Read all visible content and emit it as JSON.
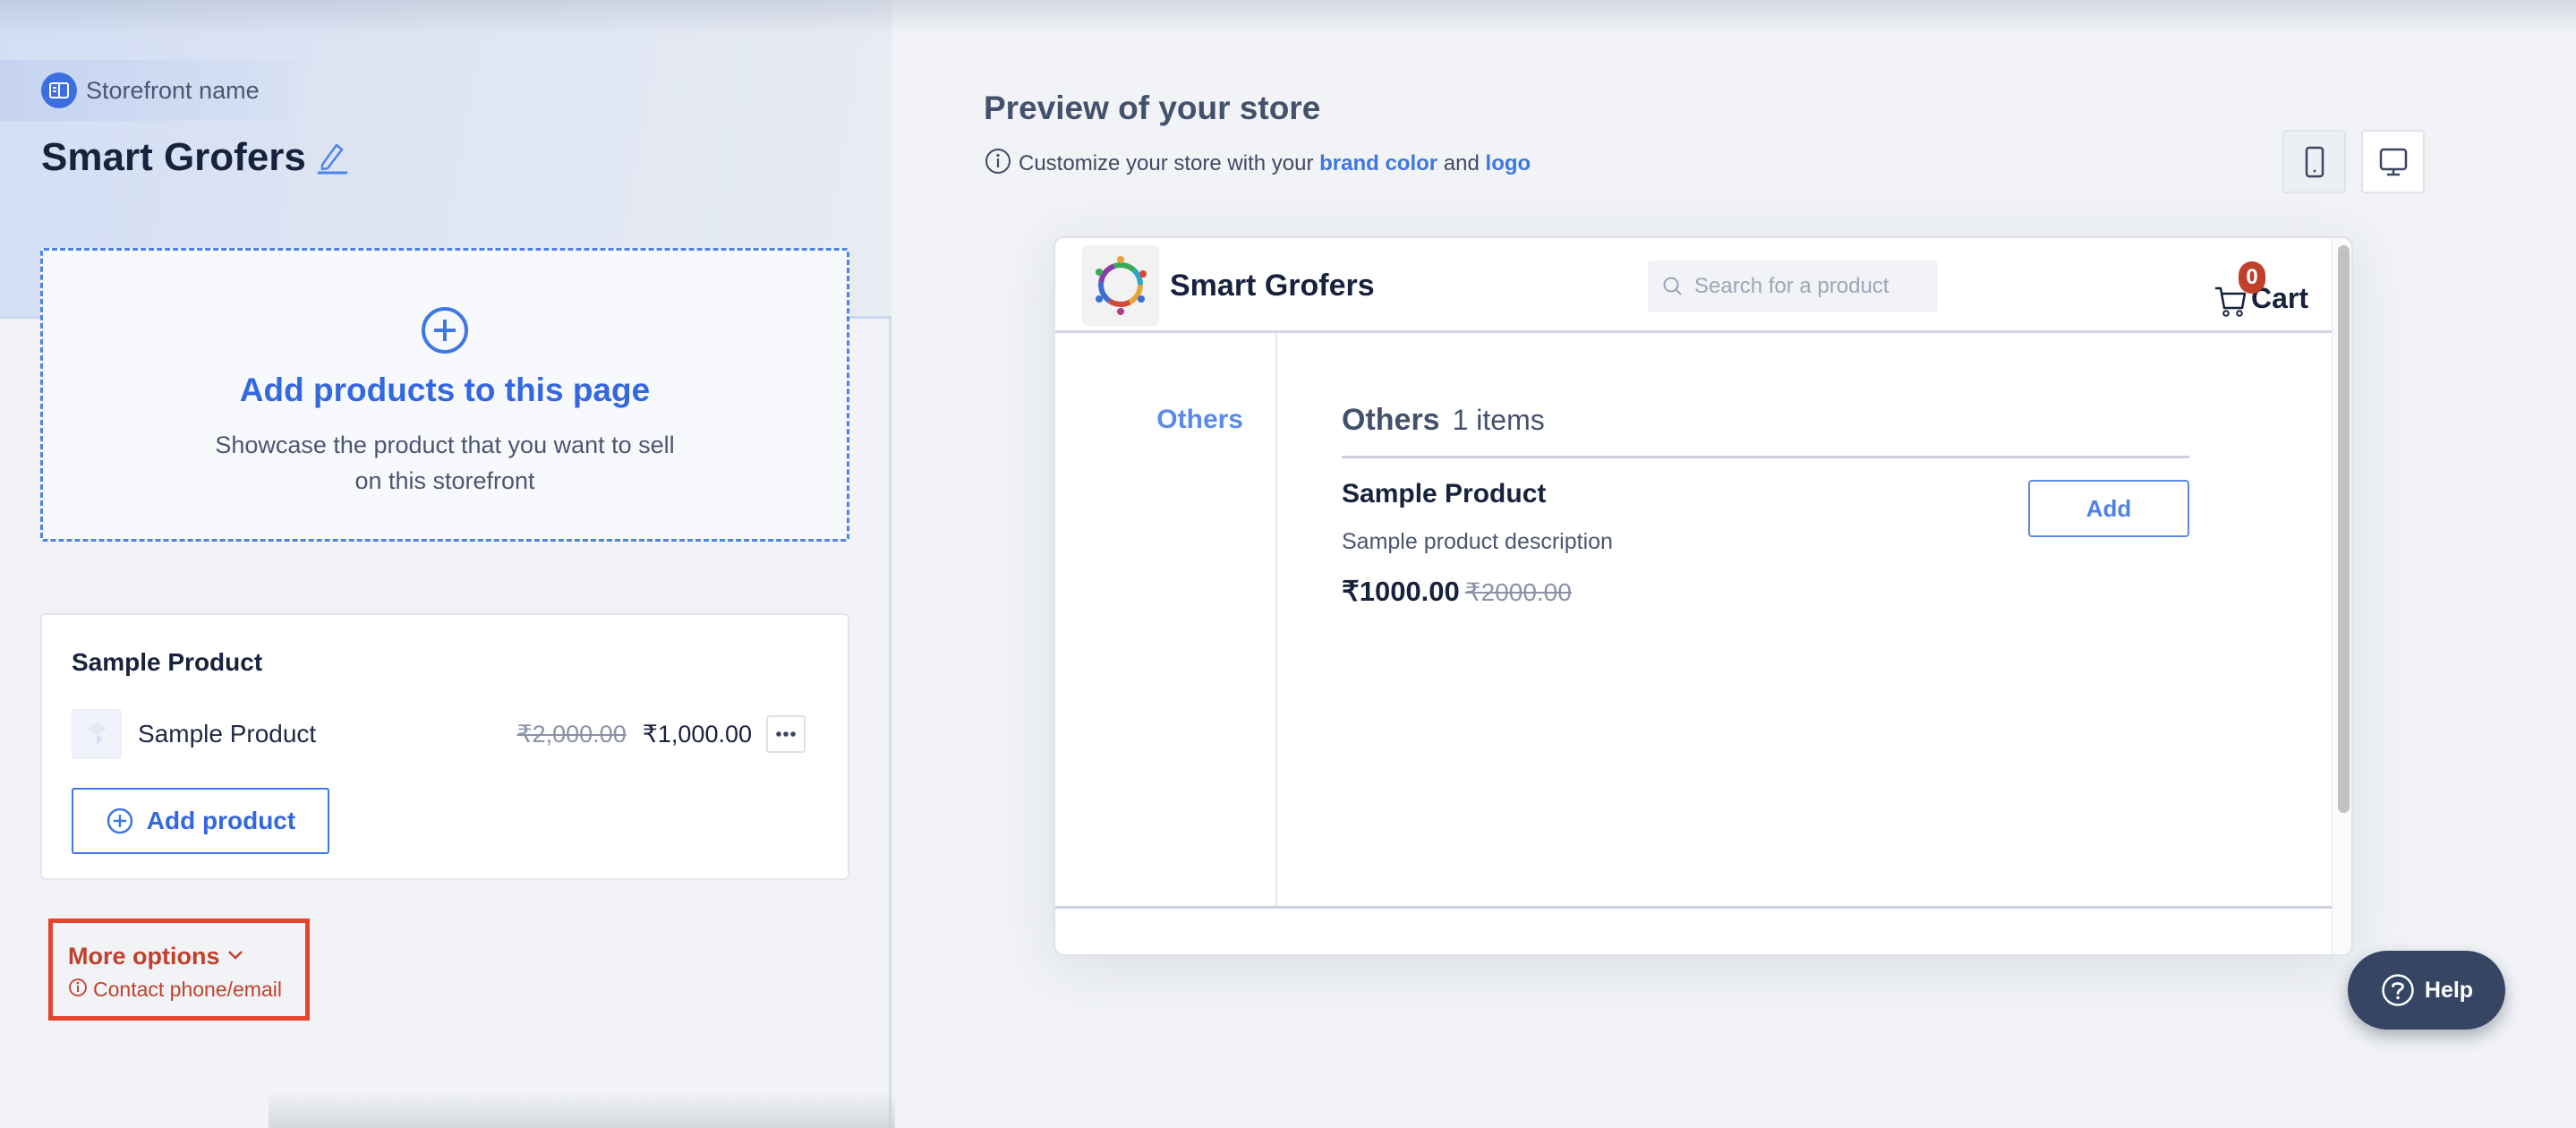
{
  "left_panel": {
    "storefront_label": "Storefront name",
    "store_name": "Smart Grofers",
    "drop_zone": {
      "title": "Add products to this page",
      "subtitle": "Showcase the product that you want to sell on this storefront"
    },
    "product_card": {
      "title": "Sample Product",
      "items": [
        {
          "name": "Sample Product",
          "original_price": "₹2,000.00",
          "price": "₹1,000.00"
        }
      ],
      "add_button_label": "Add product"
    },
    "more_options": {
      "label": "More options",
      "warning": "Contact phone/email"
    }
  },
  "right_panel": {
    "title": "Preview of your store",
    "subtitle_prefix": "Customize your store with your ",
    "subtitle_link1": "brand color",
    "subtitle_mid": " and ",
    "subtitle_link2": "logo",
    "view_modes": [
      "mobile",
      "desktop"
    ],
    "selected_view": "mobile",
    "preview": {
      "store_name": "Smart Grofers",
      "search_placeholder": "Search for a product",
      "cart_label": "Cart",
      "cart_count": "0",
      "categories": [
        "Others"
      ],
      "section": {
        "name": "Others",
        "count_label": "1 items",
        "products": [
          {
            "name": "Sample Product",
            "description": "Sample product description",
            "price": "₹1000.00",
            "original_price": "₹2000.00",
            "add_label": "Add"
          }
        ]
      }
    }
  },
  "help": {
    "label": "Help"
  },
  "colors": {
    "accent": "#3468e0",
    "warning": "#c2412c",
    "highlight_border": "#e5432b",
    "help_bg": "#364564",
    "cart_badge": "#c0412b"
  }
}
